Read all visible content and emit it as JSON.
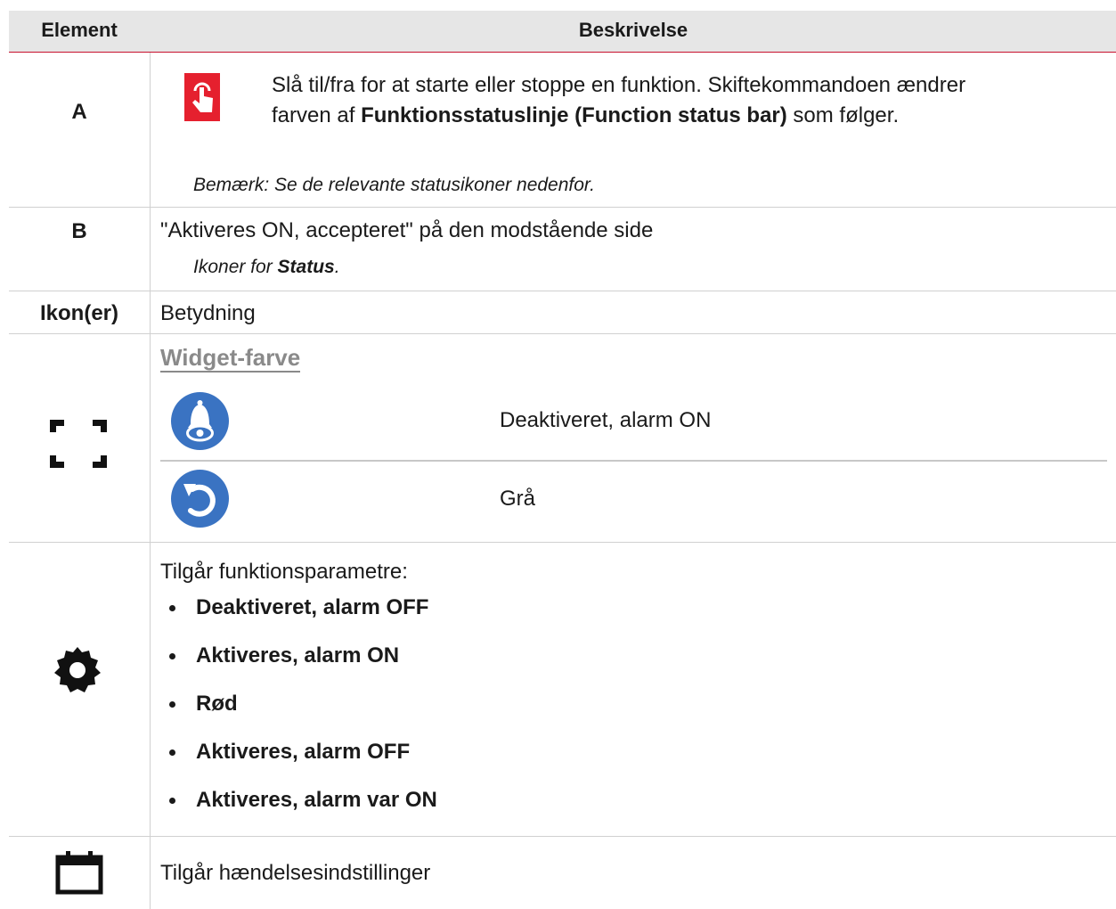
{
  "header": {
    "col_element": "Element",
    "col_description": "Beskrivelse"
  },
  "row_a": {
    "label": "A",
    "icon": "tap-hand-icon",
    "text_line1": "Slå til/fra for at starte eller stoppe en funktion. Skiftekommandoen ændrer",
    "text_line2_pre": "farven af ",
    "text_line2_bold": "Funktionsstatuslinje (Function status bar)",
    "text_line2_post": " som følger.",
    "note": "Bemærk: Se de relevante statusikoner nedenfor."
  },
  "row_b": {
    "label": "B",
    "text": "\"Aktiveres ON, accepteret\" på den modstående side",
    "sub_pre": "Ikoner for ",
    "sub_bold": "Status",
    "sub_post": "."
  },
  "row_ikon": {
    "label": "Ikon(er)",
    "text": "Betydning"
  },
  "row_widget": {
    "icon": "fullscreen-corners-icon",
    "heading": "Widget-farve",
    "items": [
      {
        "icon": "bell-eye-icon",
        "text": "Deaktiveret, alarm ON"
      },
      {
        "icon": "undo-arrow-icon",
        "text": "Grå"
      }
    ],
    "icon_color": "#3a73c2"
  },
  "row_settings": {
    "icon": "gear-icon",
    "intro": "Tilgår funktionsparametre:",
    "bullets": [
      "Deaktiveret, alarm OFF",
      "Aktiveres, alarm ON",
      "Rød",
      "Aktiveres, alarm OFF",
      "Aktiveres, alarm var ON"
    ]
  },
  "row_events": {
    "icon": "calendar-icon",
    "text": "Tilgår hændelsesindstillinger"
  },
  "colors": {
    "header_bg": "#e6e6e6",
    "header_rule": "#c8102e",
    "accent_red": "#e5202e",
    "icon_blue": "#3a73c2",
    "link_gray": "#8a8a8a"
  }
}
